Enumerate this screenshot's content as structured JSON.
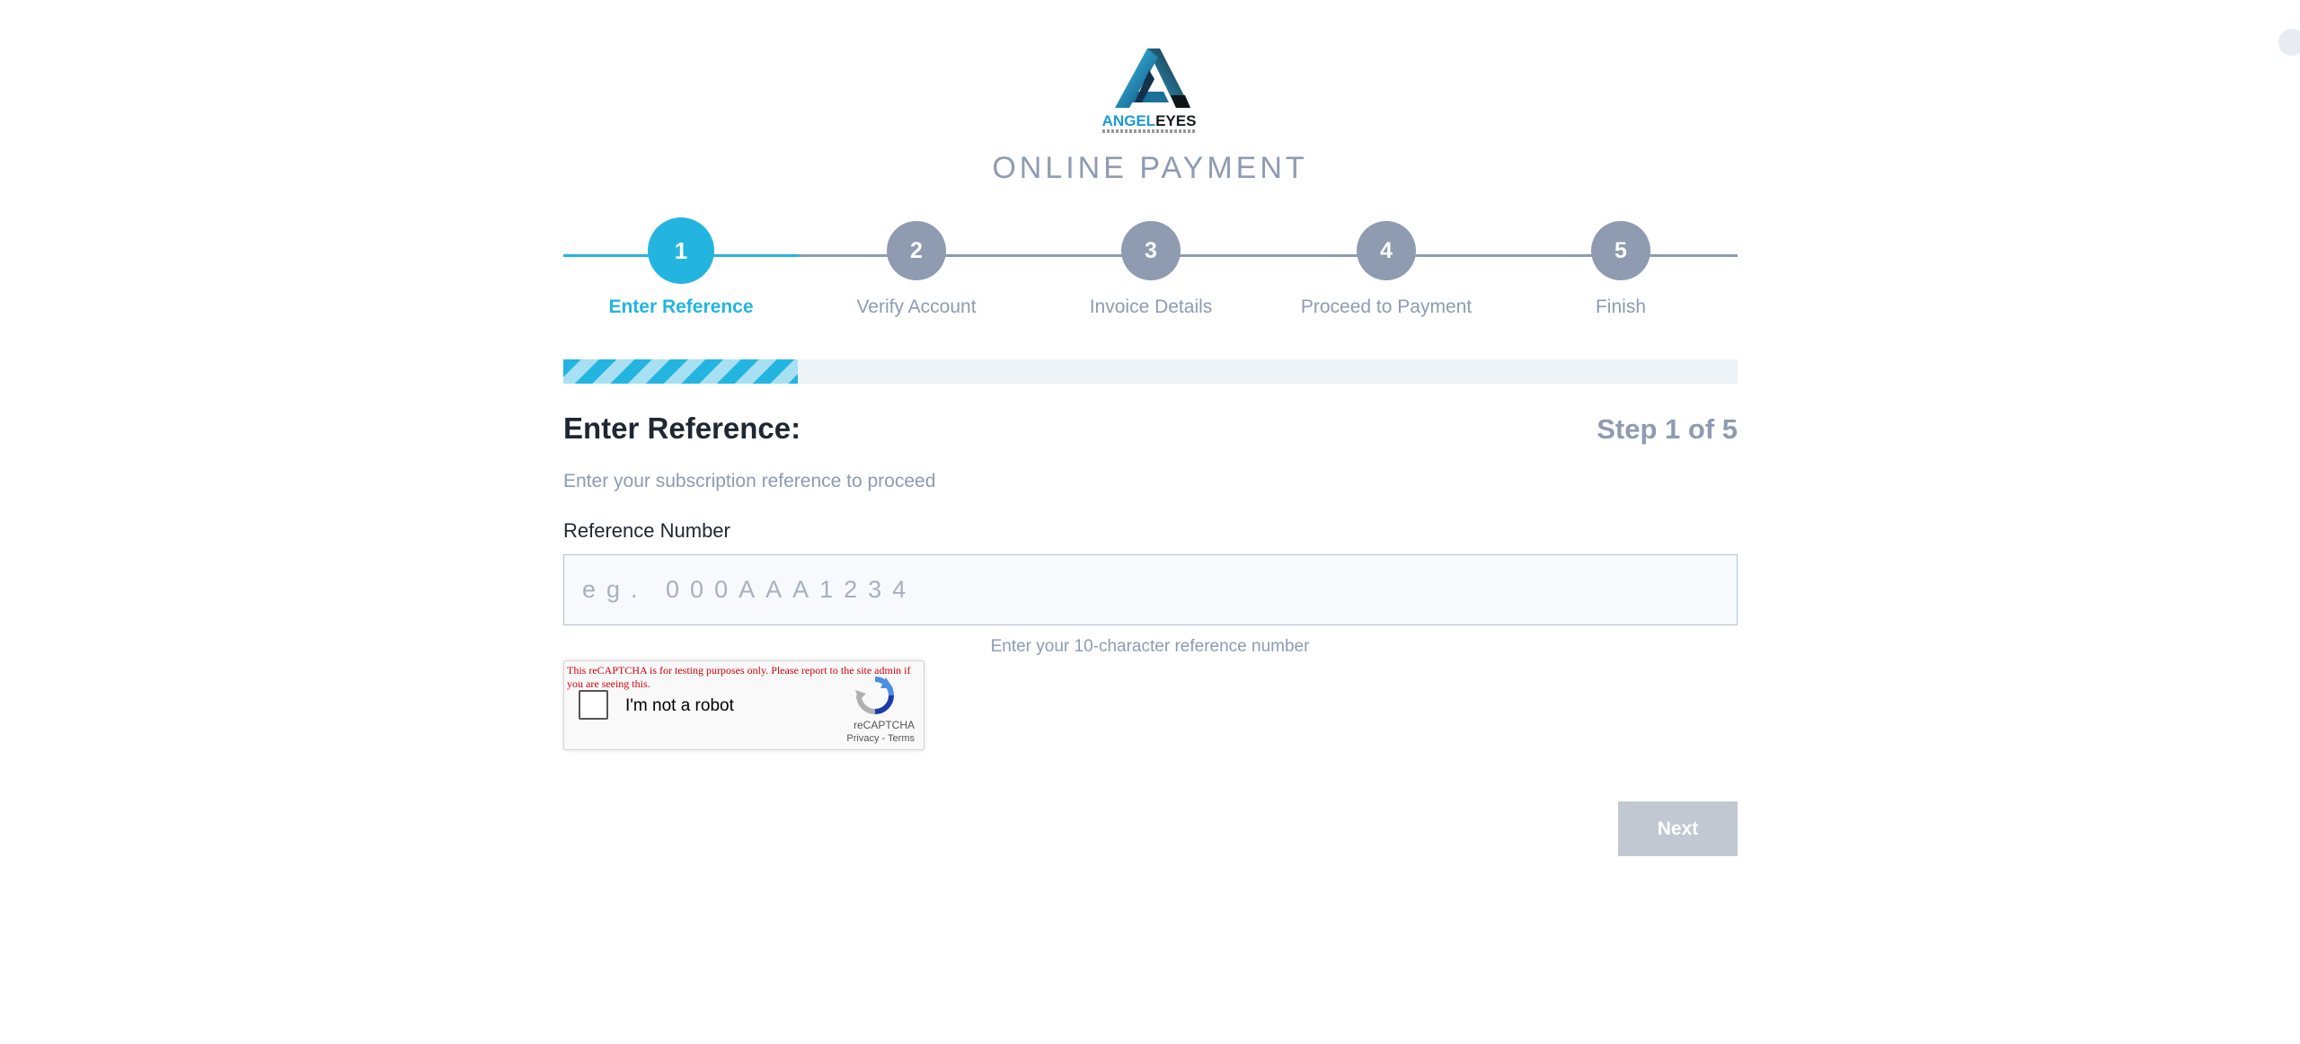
{
  "brand": {
    "name_part1": "ANGEL",
    "name_part2": "EYES"
  },
  "page_title": "ONLINE PAYMENT",
  "stepper": {
    "current_step": 1,
    "steps": [
      {
        "number": "1",
        "label": "Enter Reference"
      },
      {
        "number": "2",
        "label": "Verify Account"
      },
      {
        "number": "3",
        "label": "Invoice Details"
      },
      {
        "number": "4",
        "label": "Proceed to Payment"
      },
      {
        "number": "5",
        "label": "Finish"
      }
    ]
  },
  "progress": {
    "percent": 20
  },
  "form": {
    "heading": "Enter Reference:",
    "step_count": "Step 1 of 5",
    "description": "Enter your subscription reference to proceed",
    "field_label": "Reference Number",
    "placeholder": "eg. 000AAA1234",
    "value": "",
    "help_text": "Enter your 10-character reference number"
  },
  "recaptcha": {
    "warning": "This reCAPTCHA is for testing purposes only. Please report to the site admin if you are seeing this.",
    "label": "I'm not a robot",
    "brand": "reCAPTCHA",
    "privacy": "Privacy",
    "separator": "-",
    "terms": "Terms",
    "checked": false
  },
  "actions": {
    "next_label": "Next"
  },
  "colors": {
    "accent": "#23b5e0",
    "muted": "#8e9bb1",
    "disabled_button": "#c2c8d2",
    "warning": "#d8000c"
  },
  "icons": {
    "logo": "angel-eyes-logo-icon",
    "recaptcha": "recaptcha-logo-icon"
  }
}
